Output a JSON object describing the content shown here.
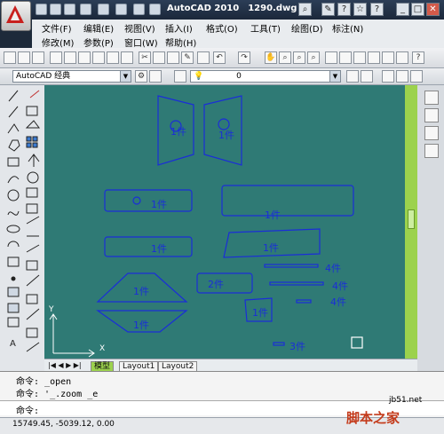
{
  "titlebar": {
    "app_name": "AutoCAD 2010",
    "file_name": "1290.dwg"
  },
  "menus": {
    "row1": [
      "文件(F)",
      "编辑(E)",
      "视图(V)",
      "插入(I)",
      "格式(O)",
      "工具(T)",
      "绘图(D)",
      "标注(N)"
    ],
    "row2": [
      "修改(M)",
      "参数(P)",
      "窗口(W)",
      "帮助(H)"
    ]
  },
  "toolbar2": {
    "workspace": "AutoCAD 经典",
    "layer": "0"
  },
  "layouts": {
    "model": "模型",
    "layout1": "Layout1",
    "layout2": "Layout2"
  },
  "drawing_labels": {
    "p1": "1件",
    "p2": "1件",
    "p3": "1件",
    "p4": "1件",
    "p5": "1件",
    "p6": "1件",
    "p7": "1件",
    "p8": "1件",
    "p9": "2件",
    "p10": "1件",
    "p11": "1件",
    "s1": "4件",
    "s2": "4件",
    "s3": "4件",
    "s4": "3件",
    "y_axis": "Y",
    "x_axis": "X"
  },
  "command": {
    "line1_prompt": "命令:",
    "line1_text": " _open",
    "line2_prompt": "命令:",
    "line2_text": " '_.zoom _e",
    "line3_prompt": "命令:"
  },
  "status": {
    "coordinates": "15749.45, -5039.12, 0.00"
  },
  "watermark": {
    "site": "脚本之家",
    "url": "jb51.net"
  },
  "colors": {
    "canvas": "#2f7a75",
    "geometry": "#1a2dd8",
    "scrollbar": "#9cd24d"
  }
}
